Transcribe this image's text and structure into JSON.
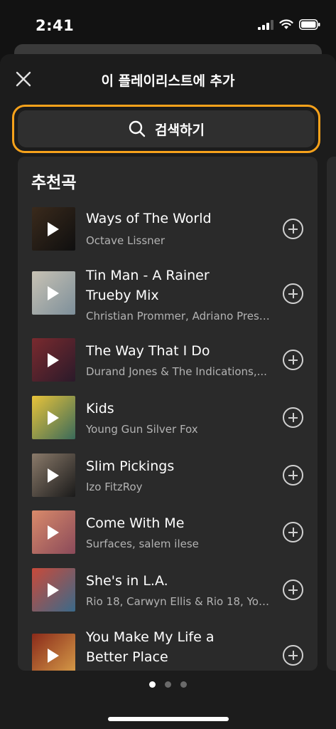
{
  "status_bar": {
    "time": "2:41"
  },
  "header": {
    "title": "이 플레이리스트에 추가"
  },
  "search": {
    "label": "검색하기"
  },
  "recommendations": {
    "title": "추천곡",
    "tracks": [
      {
        "title": "Ways of The World",
        "artist": "Octave Lissner",
        "art_colors": [
          "#3a2a1c",
          "#0f0f0f"
        ]
      },
      {
        "title": "Tin Man - A Rainer Trueby Mix",
        "artist": "Christian Prommer, Adriano Prest...",
        "art_colors": [
          "#c8c2b4",
          "#7d8f9a"
        ]
      },
      {
        "title": "The Way That I Do",
        "artist": "Durand Jones & The Indications,...",
        "art_colors": [
          "#7a2a2e",
          "#2a1a2a"
        ]
      },
      {
        "title": "Kids",
        "artist": "Young Gun Silver Fox",
        "art_colors": [
          "#e8c33a",
          "#3a6a5a"
        ]
      },
      {
        "title": "Slim Pickings",
        "artist": "Izo FitzRoy",
        "art_colors": [
          "#8a7a6a",
          "#1a1a1a"
        ]
      },
      {
        "title": "Come With Me",
        "artist": "Surfaces, salem ilese",
        "art_colors": [
          "#d98a6a",
          "#8a4a5a"
        ]
      },
      {
        "title": "She's in L.A.",
        "artist": "Rio 18, Carwyn Ellis & Rio 18, Youn...",
        "art_colors": [
          "#c94a3a",
          "#3a6a8a"
        ]
      },
      {
        "title": "You Make My Life a Better Place",
        "artist": "",
        "art_colors": [
          "#8a2a1a",
          "#d9a04a"
        ]
      }
    ]
  },
  "pagination": {
    "count": 3,
    "active": 0
  },
  "colors": {
    "accent": "#f7a21b",
    "background": "#1c1c1c",
    "card": "#2a2a2a"
  }
}
